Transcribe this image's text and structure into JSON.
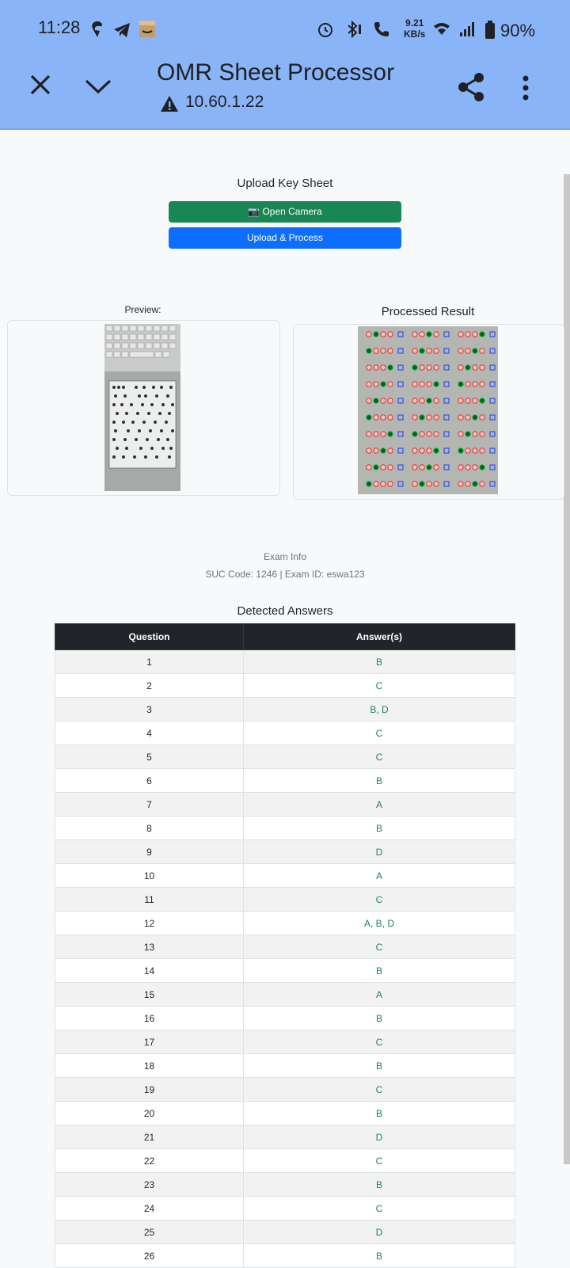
{
  "status_bar": {
    "time": "11:28",
    "net_speed_value": "9.21",
    "net_speed_unit": "KB/s",
    "battery": "90%"
  },
  "browser": {
    "title": "OMR Sheet Processor",
    "url": "10.60.1.22"
  },
  "upload": {
    "title": "Upload Key Sheet",
    "camera_button": "📷 Open Camera",
    "process_button": "Upload & Process"
  },
  "preview": {
    "label": "Preview:"
  },
  "processed": {
    "label": "Processed Result"
  },
  "exam": {
    "heading": "Exam Info",
    "details": "SUC Code: 1246 | Exam ID: eswa123"
  },
  "answers": {
    "title": "Detected Answers",
    "col_question": "Question",
    "col_answer": "Answer(s)",
    "rows": [
      {
        "q": "1",
        "a": "B"
      },
      {
        "q": "2",
        "a": "C"
      },
      {
        "q": "3",
        "a": "B, D"
      },
      {
        "q": "4",
        "a": "C"
      },
      {
        "q": "5",
        "a": "C"
      },
      {
        "q": "6",
        "a": "B"
      },
      {
        "q": "7",
        "a": "A"
      },
      {
        "q": "8",
        "a": "B"
      },
      {
        "q": "9",
        "a": "D"
      },
      {
        "q": "10",
        "a": "A"
      },
      {
        "q": "11",
        "a": "C"
      },
      {
        "q": "12",
        "a": "A, B, D"
      },
      {
        "q": "13",
        "a": "C"
      },
      {
        "q": "14",
        "a": "B"
      },
      {
        "q": "15",
        "a": "A"
      },
      {
        "q": "16",
        "a": "B"
      },
      {
        "q": "17",
        "a": "C"
      },
      {
        "q": "18",
        "a": "B"
      },
      {
        "q": "19",
        "a": "C"
      },
      {
        "q": "20",
        "a": "B"
      },
      {
        "q": "21",
        "a": "D"
      },
      {
        "q": "22",
        "a": "C"
      },
      {
        "q": "23",
        "a": "B"
      },
      {
        "q": "24",
        "a": "C"
      },
      {
        "q": "25",
        "a": "D"
      },
      {
        "q": "26",
        "a": "B"
      }
    ]
  },
  "colors": {
    "header_bg": "#8ab4f8",
    "green": "#198754",
    "blue": "#0d6efd",
    "table_head": "#212529"
  },
  "icons": [
    "close-icon",
    "chevron-down-icon",
    "warning-icon",
    "share-icon",
    "more-vert-icon",
    "alarm-icon",
    "bluetooth-icon",
    "call-icon",
    "wifi-icon",
    "signal-icon",
    "battery-icon"
  ]
}
